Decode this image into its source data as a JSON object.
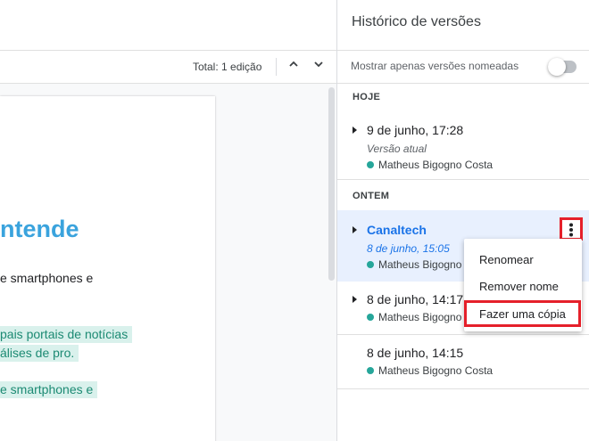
{
  "toolbar": {
    "total_label": "Total: 1 edição",
    "prev_icon": "chevron-up-icon",
    "next_icon": "chevron-down-icon"
  },
  "document": {
    "heading": "ntende",
    "lines": [
      "e smartphones e",
      "pais portais de notícias",
      "álises de pro.",
      "e smartphones e"
    ]
  },
  "panel": {
    "title": "Histórico de versões",
    "named_only_label": "Mostrar apenas versões nomeadas",
    "named_only_toggle": false,
    "sections": {
      "today": "HOJE",
      "yesterday": "ONTEM"
    },
    "versions": [
      {
        "title": "9 de junho, 17:28",
        "subtitle": "Versão atual",
        "author": "Matheus Bigogno Costa"
      },
      {
        "title": "Canaltech",
        "subtitle": "8 de junho, 15:05",
        "author": "Matheus Bigogno Costa",
        "selected": true
      },
      {
        "title": "8 de junho, 14:17",
        "author": "Matheus Bigogno Costa"
      },
      {
        "title": "8 de junho, 14:15",
        "author": "Matheus Bigogno Costa"
      }
    ],
    "more_icon": "more-vert-icon"
  },
  "menu": {
    "items": [
      "Renomear",
      "Remover nome",
      "Fazer uma cópia"
    ]
  },
  "colors": {
    "accent": "#1a73e8",
    "highlight_red": "#e5202a",
    "author_dot": "#26a69a",
    "heading_blue": "#3aa3dd",
    "text_highlight": "#d9f1ec"
  }
}
